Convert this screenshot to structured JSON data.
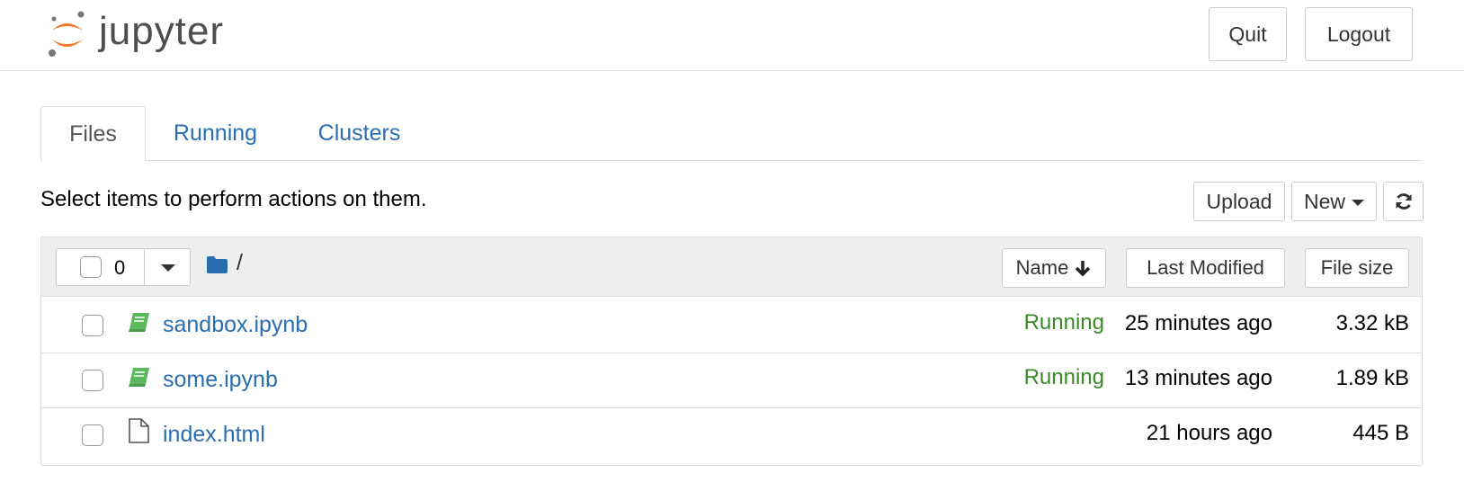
{
  "header": {
    "logo_text": "jupyter",
    "quit_label": "Quit",
    "logout_label": "Logout",
    "logo_colors": {
      "orange": "#f37726",
      "gray": "#767677"
    }
  },
  "tabs": [
    {
      "label": "Files",
      "active": true
    },
    {
      "label": "Running",
      "active": false
    },
    {
      "label": "Clusters",
      "active": false
    }
  ],
  "toolbar": {
    "hint": "Select items to perform actions on them.",
    "upload_label": "Upload",
    "new_label": "New",
    "refresh_icon": "refresh-icon"
  },
  "list_header": {
    "selected_count": "0",
    "path": "/",
    "sort_name_label": "Name",
    "sort_name_icon": "arrow-down-icon",
    "sort_modified_label": "Last Modified",
    "sort_size_label": "File size"
  },
  "files": [
    {
      "name": "sandbox.ipynb",
      "type": "notebook",
      "status": "Running",
      "modified": "25 minutes ago",
      "size": "3.32 kB"
    },
    {
      "name": "some.ipynb",
      "type": "notebook",
      "status": "Running",
      "modified": "13 minutes ago",
      "size": "1.89 kB"
    },
    {
      "name": "index.html",
      "type": "file",
      "status": "",
      "modified": "21 hours ago",
      "size": "445 B"
    }
  ],
  "colors": {
    "link": "#2a6db0",
    "running": "#3a8a2a",
    "notebook_icon": "#5cb85c",
    "folder_icon": "#2a6db0"
  }
}
